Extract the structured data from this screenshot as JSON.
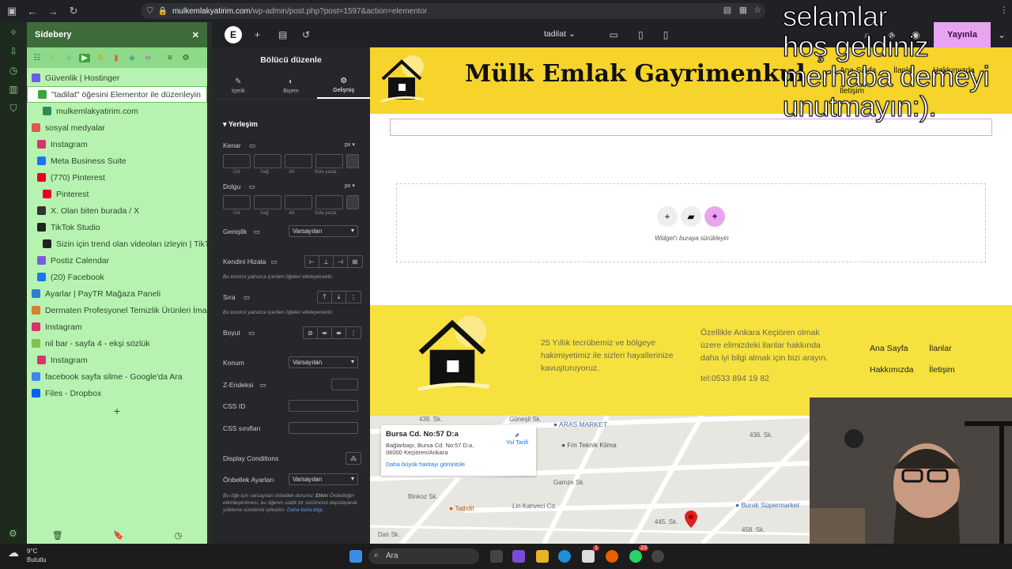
{
  "browser": {
    "url_host": "mulkemlakyatirim.com",
    "url_path": "/wp-admin/post.php?post=1597&action=elementor"
  },
  "sidebery": {
    "title": "Sidebery",
    "tabs": [
      {
        "label": "Güvenlik | Hostinger",
        "level": 0,
        "color": "#6c5ce7"
      },
      {
        "label": "\"tadilat\" öğesini Elementor ile düzenleyin",
        "level": 1,
        "color": "#3aa53a",
        "active": true
      },
      {
        "label": "mulkemlakyatirim.com",
        "level": 2,
        "color": "#2e8b57"
      },
      {
        "label": "sosyal medyalar",
        "level": 0,
        "color": "#e05555"
      },
      {
        "label": "Instagram",
        "level": 1,
        "color": "#d6336c"
      },
      {
        "label": "Meta Business Suite",
        "level": 1,
        "color": "#1877f2"
      },
      {
        "label": "(770) Pinterest",
        "level": 1,
        "color": "#e60023"
      },
      {
        "label": "Pinterest",
        "level": 2,
        "color": "#e60023"
      },
      {
        "label": "X. Olan biten burada / X",
        "level": 1,
        "color": "#333333"
      },
      {
        "label": "TikTok Studio",
        "level": 1,
        "color": "#222222"
      },
      {
        "label": "Sizin için trend olan videoları izleyin | TikTok",
        "level": 2,
        "color": "#222222"
      },
      {
        "label": "Postiz Calendar",
        "level": 1,
        "color": "#7b5cd6"
      },
      {
        "label": "(20) Facebook",
        "level": 1,
        "color": "#1877f2"
      },
      {
        "label": "Ayarlar | PayTR Mağaza Paneli",
        "level": 0,
        "color": "#2d7dd2"
      },
      {
        "label": "Dermaten Profesyonel Temizlik Ürünleri İmalatı",
        "level": 0,
        "color": "#e07b2d"
      },
      {
        "label": "Instagram",
        "level": 0,
        "color": "#d6336c"
      },
      {
        "label": "nil bar - sayfa 4 - ekşi sözlük",
        "level": 0,
        "color": "#81c14b"
      },
      {
        "label": "Instagram",
        "level": 1,
        "color": "#d6336c"
      },
      {
        "label": "facebook sayfa silme - Google'da Ara",
        "level": 0,
        "color": "#4285f4"
      },
      {
        "label": "Files - Dropbox",
        "level": 0,
        "color": "#0061ff"
      }
    ],
    "add_label": "+"
  },
  "editor": {
    "topbar": {
      "page_name": "tadilat",
      "publish": "Yayınla"
    },
    "panel": {
      "title": "Bölücü düzenle",
      "tabs": [
        "İçerik",
        "Biçem",
        "Gelişmiş"
      ],
      "section": "Yerleşim",
      "kenar": "Kenar",
      "dolgu": "Dolgu",
      "unit": "px",
      "sides": [
        "Üst",
        "Sağ",
        "Alt",
        "Sola yasla"
      ],
      "genislik": "Genişlik",
      "genislik_value": "Varsayılan",
      "kendini_hizala": "Kendini Hizala",
      "note1": "Bu kontrol yalnızca içerilen öğeleri etkileyecektir.",
      "sira": "Sıra",
      "note2": "Bu kontrol yalnızca içerilen öğeleri etkileyecektir.",
      "boyut": "Boyut",
      "konum": "Konum",
      "konum_value": "Varsayılan",
      "z_endeksi": "Z-Endeksi",
      "css_id": "CSS ID",
      "css_siniflari": "CSS sınıfları",
      "display_conditions": "Display Conditions",
      "onbellek": "Önbellek Ayarları",
      "onbellek_value": "Varsayılan",
      "cache_note_a": "Bu öğe için varsayılan önbellek durumu:",
      "cache_note_b": "Etkin",
      "cache_note_c": "Önbelleğin etkinleştirilmesi, bu öğenin statik bir sürümünü depolayarak yükleme sürelerini iyileştirir.",
      "cache_link": "Daha fazla bilgi."
    }
  },
  "site": {
    "title": "Mülk Emlak Gayrimenkul",
    "nav": [
      "Ana Sayfa",
      "İlanlar",
      "Hakkımızda",
      "İletişim"
    ],
    "dropzone_label": "Widget'ı buraya sürükleyin",
    "footer_text1": "25 Yıllık tecrübemiz ve bölgeye hakimiyetimiz ile sizleri hayallerinize kavuşturuyoruz.",
    "footer_text2": "Özellikle Ankara Keçiören olmak üzere elimizdeki ilanlar hakkında daha iyi bilgi almak için bizi arayın.",
    "footer_phone": "tel:0533 894 19 82",
    "footer_nav": [
      "Ana Sayfa",
      "İlanlar",
      "Hakkımızda",
      "İletişim"
    ],
    "map": {
      "place_title": "Bursa Cd. No:57 D:a",
      "address": "Bağlarbaşı, Bursa Cd. No:57 D:a, 06000 Keçiören/Ankara",
      "directions": "Yol Tarifi",
      "larger_map": "Daha büyük haritayı görüntüle",
      "labels": [
        "439. Sk.",
        "Güneşli Sk.",
        "ARAS MARKET",
        "Fm Teknik Klima",
        "436. Sk.",
        "Binkoz Sk.",
        "Tatlıdil",
        "Gamze Sk.",
        "Burak Süpermarket",
        "445. Sk.",
        "458. Sk.",
        "Dalı Sk.",
        "Lin Kahveci Cd."
      ]
    }
  },
  "overlay_greeting": [
    "selamlar",
    "hoş geldiniz",
    "merhaba demeyi",
    "unutmayın:)."
  ],
  "taskbar": {
    "temp": "9°C",
    "condition": "Bulutlu",
    "search": "Ara",
    "badge1": "1",
    "badge2": "23"
  }
}
